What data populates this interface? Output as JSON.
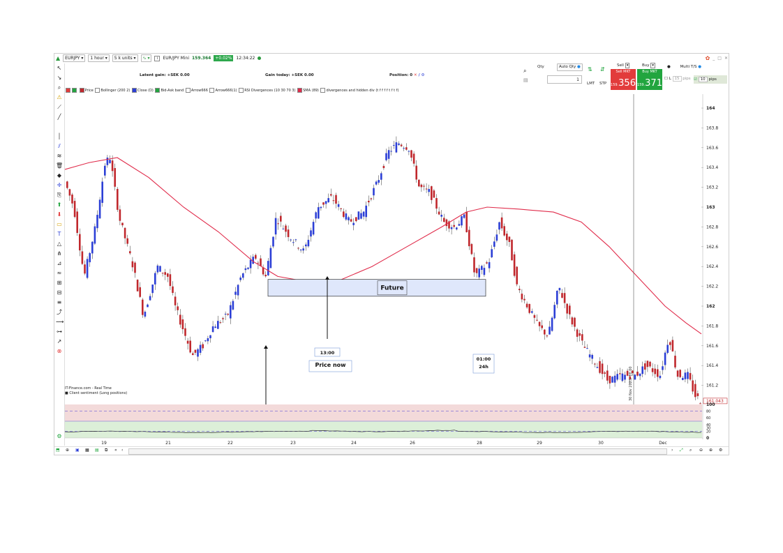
{
  "titlebar": {
    "symbol": "EURJPY",
    "timeframe": "1 hour",
    "units": "5 k units",
    "instrument": "EUR/JPY Mini",
    "price": "159.364",
    "change": "+0.02%",
    "time": "12:34:22"
  },
  "info": {
    "latent_gain": "Latent gain:  +SEK 0.00",
    "gain_today": "Gain today:  +SEK 0.00",
    "position": "Position:  0"
  },
  "trade": {
    "qty_label": "Qty",
    "auto_qty": "Auto Qty",
    "qty_value": "1",
    "lmt": "LMT",
    "stp": "STP",
    "sell_label": "Sell",
    "buy_label": "Buy",
    "sell_mkt": "Sell MKT",
    "buy_mkt": "Buy MKT",
    "sell_small": "159.",
    "sell_big": "356",
    "buy_small": "159.",
    "buy_big": "371",
    "multi_ts": "Multi T/S",
    "l_label": "L",
    "l_pips": "15",
    "pips": "pips",
    "pips_value": "10",
    "pips_label": "pips"
  },
  "indicators": [
    "Price",
    "Bollinger (200 2)",
    "Close (D)",
    "Bid-Ask band",
    "Arrow666",
    "Arrow666(1)",
    "RSI Divergences (10 30 70 3)",
    "SMA (89)",
    "divergences and hidden div (t f f f f t f t f)"
  ],
  "chart_data": {
    "type": "line",
    "series": [
      {
        "name": "Price",
        "x": [
          "19",
          "21",
          "22",
          "23",
          "24",
          "26",
          "28",
          "29",
          "30",
          "Dec"
        ],
        "values": [
          163.3,
          162.0,
          161.7,
          162.8,
          163.0,
          163.7,
          162.9,
          162.2,
          161.4,
          161.05
        ]
      },
      {
        "name": "SMA (89)",
        "x": [
          "19",
          "21",
          "22",
          "23",
          "24",
          "26",
          "28",
          "29",
          "30",
          "Dec"
        ],
        "values": [
          163.4,
          163.1,
          162.6,
          162.3,
          162.25,
          162.5,
          163.0,
          162.95,
          162.3,
          161.8
        ]
      }
    ],
    "yticks": [
      "164",
      "163.8",
      "163.6",
      "163.4",
      "163.2",
      "163",
      "162.8",
      "162.6",
      "162.4",
      "162.2",
      "162",
      "161.8",
      "161.6",
      "161.4",
      "161.2"
    ],
    "xticks": [
      "19",
      "21",
      "22",
      "23",
      "24",
      "26",
      "28",
      "29",
      "30",
      "Dec"
    ],
    "last_price": "161.043",
    "ylim": [
      161.1,
      164.1
    ],
    "source": "IT-Finance.com - Real Time",
    "vertical_label": "30 Nov 2023, 12:00",
    "annotations": {
      "future": "Future",
      "now_time": "13:00",
      "now_label": "Price now",
      "left_time": "13:00",
      "right_time": "01:00",
      "right_sub": "24h"
    }
  },
  "sentiment": {
    "title": "Client sentiment (Long positions)",
    "yticks": [
      "100",
      "80",
      "60",
      "40",
      "30",
      "20",
      "0"
    ]
  },
  "colors": {
    "up": "#2c3fd6",
    "down": "#c0282d",
    "sma": "#e02b4a",
    "sell": "#e23b3b",
    "buy": "#22a53f"
  }
}
